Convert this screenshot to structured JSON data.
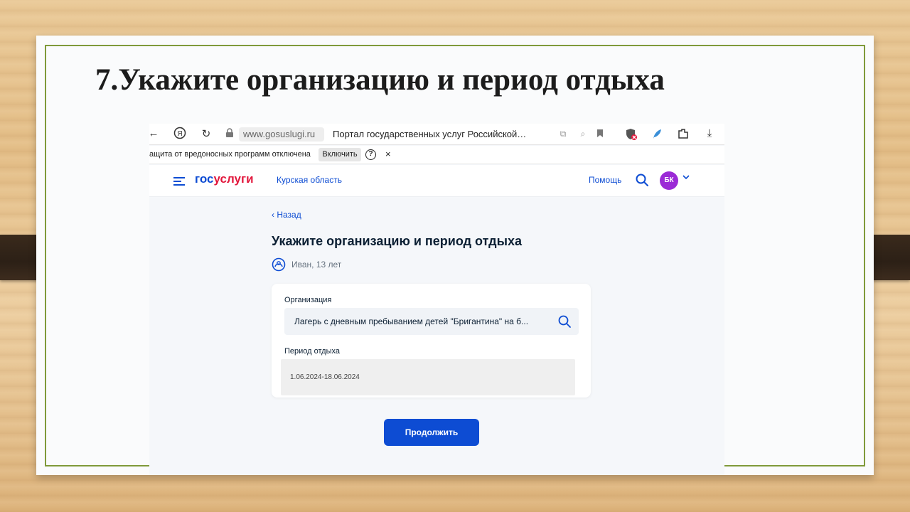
{
  "slide": {
    "title": "7.Укажите организацию и период отдыха"
  },
  "browser": {
    "url": "www.gosuslugi.ru",
    "tab_title": "Портал государственных услуг Российской…",
    "protection_text": "ащита от вредоносных программ отключена",
    "enable_label": "Включить",
    "help_glyph": "?",
    "close_glyph": "×"
  },
  "site_header": {
    "logo_gos": "гос",
    "logo_uslugi": "услуги",
    "region": "Курская область",
    "help_label": "Помощь",
    "avatar_initials": "БК"
  },
  "main": {
    "back_label": "‹  Назад",
    "title": "Укажите организацию и период отдыха",
    "child_label": "Иван, 13 лет",
    "organization_label": "Организация",
    "organization_value": "Лагерь с дневным пребыванием детей \"Бригантина\" на б...",
    "period_label": "Период отдыха",
    "period_value": "1.06.2024-18.06.2024",
    "continue_label": "Продолжить"
  },
  "colors": {
    "brand_blue": "#0d4cd3",
    "brand_red": "#e2173c",
    "frame_green": "#7f9a3a",
    "avatar_purple": "#9b2ad6"
  }
}
